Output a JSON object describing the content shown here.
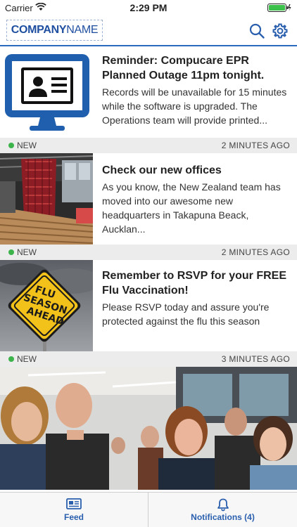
{
  "status_bar": {
    "carrier": "Carrier",
    "time": "2:29 PM"
  },
  "header": {
    "logo_company": "COMPANY",
    "logo_name": "NAME"
  },
  "feed": {
    "items": [
      {
        "title": "Reminder: Compucare EPR Planned Outage 11pm tonight.",
        "body": "Records will be unavailable for 15 minutes while the software is upgraded. The Operations team will provide printed...",
        "badge": "NEW",
        "time": "2 MINUTES AGO"
      },
      {
        "title": "Check our new offices",
        "body": "As you know, the New Zealand team has moved into our awesome new headquarters in Takapuna Beack, Aucklan...",
        "badge": "NEW",
        "time": "2 MINUTES AGO"
      },
      {
        "title": "Remember to RSVP for your FREE Flu Vaccination!",
        "body": "Please RSVP today and assure you're protected against the flu this season",
        "sign_lines": [
          "FLU",
          "SEASON",
          "AHEAD"
        ],
        "badge": "NEW",
        "time": "3 MINUTES AGO"
      }
    ]
  },
  "tabs": [
    {
      "label": "Feed",
      "icon": "newspaper-icon"
    },
    {
      "label": "Notifications (4)",
      "icon": "bell-icon"
    }
  ],
  "colors": {
    "accent": "#2a5fae",
    "new_dot": "#3cb44b",
    "meta_bg": "#ececec"
  }
}
